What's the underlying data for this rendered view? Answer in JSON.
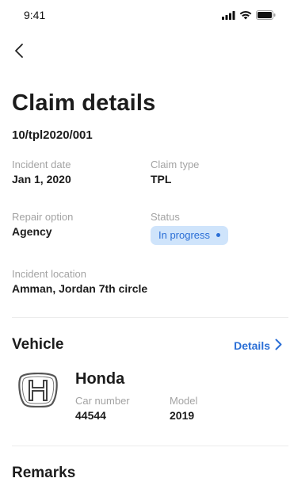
{
  "status_bar": {
    "time": "9:41"
  },
  "page": {
    "title": "Claim details",
    "claim_number": "10/tpl2020/001"
  },
  "fields": {
    "incident_date": {
      "label": "Incident date",
      "value": "Jan 1, 2020"
    },
    "claim_type": {
      "label": "Claim type",
      "value": "TPL"
    },
    "repair_option": {
      "label": "Repair option",
      "value": "Agency"
    },
    "status": {
      "label": "Status",
      "value": "In progress",
      "color": "#2b6fd6",
      "background": "#cfe4fb"
    },
    "incident_location": {
      "label": "Incident location",
      "value": "Amman, Jordan 7th circle"
    }
  },
  "vehicle": {
    "section_title": "Vehicle",
    "details_link": "Details",
    "logo_icon": "honda-logo-icon",
    "make": "Honda",
    "car_number": {
      "label": "Car number",
      "value": "44544"
    },
    "model": {
      "label": "Model",
      "value": "2019"
    }
  },
  "remarks": {
    "section_title": "Remarks"
  },
  "colors": {
    "accent": "#2b6fd6",
    "text": "#1c1c1c",
    "muted": "#a3a3a3"
  }
}
